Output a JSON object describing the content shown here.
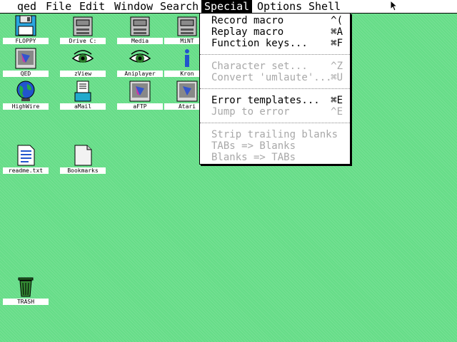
{
  "menubar": {
    "items": [
      {
        "label": "qed"
      },
      {
        "label": "File"
      },
      {
        "label": "Edit"
      },
      {
        "label": "Window"
      },
      {
        "label": "Search"
      },
      {
        "label": "Special"
      },
      {
        "label": "Options"
      },
      {
        "label": "Shell"
      }
    ]
  },
  "desktop": {
    "icons": [
      {
        "label": "FLOPPY",
        "icon": "floppy-icon"
      },
      {
        "label": "Drive C:",
        "icon": "drive-icon"
      },
      {
        "label": "Media",
        "icon": "drive-icon"
      },
      {
        "label": "MiNT",
        "icon": "drive-icon"
      },
      {
        "label": "QED",
        "icon": "program-icon"
      },
      {
        "label": "zView",
        "icon": "eye-icon"
      },
      {
        "label": "Aniplayer",
        "icon": "eye-icon"
      },
      {
        "label": "Kron",
        "icon": "info-icon"
      },
      {
        "label": "HighWire",
        "icon": "globe-icon"
      },
      {
        "label": "aMail",
        "icon": "mail-icon"
      },
      {
        "label": "aFTP",
        "icon": "program-icon"
      },
      {
        "label": "Atari",
        "icon": "program-icon"
      },
      {
        "label": "readme.txt",
        "icon": "text-file-icon"
      },
      {
        "label": "Bookmarks",
        "icon": "file-icon"
      },
      {
        "label": "TRASH",
        "icon": "trash-icon"
      }
    ]
  },
  "special_menu": {
    "items": [
      {
        "label": "Record macro",
        "shortcut": "^(",
        "enabled": true
      },
      {
        "label": "Replay macro",
        "shortcut": "⌘A",
        "enabled": true
      },
      {
        "label": "Function keys...",
        "shortcut": "⌘F",
        "enabled": true
      },
      {
        "label": "Character set...",
        "shortcut": "^Z",
        "enabled": false
      },
      {
        "label": "Convert 'umlaute'...",
        "shortcut": "⌘U",
        "enabled": false
      },
      {
        "label": "Error templates...",
        "shortcut": "⌘E",
        "enabled": true
      },
      {
        "label": "Jump to error",
        "shortcut": "^E",
        "enabled": false
      },
      {
        "label": "Strip trailing blanks",
        "shortcut": "",
        "enabled": false
      },
      {
        "label": "TABs => Blanks",
        "shortcut": "",
        "enabled": false
      },
      {
        "label": "Blanks => TABs",
        "shortcut": "",
        "enabled": false
      }
    ]
  },
  "colors": {
    "desktop": "#66dd88",
    "menubar": "#ffffff",
    "disabled_text": "#a8a8a8"
  }
}
